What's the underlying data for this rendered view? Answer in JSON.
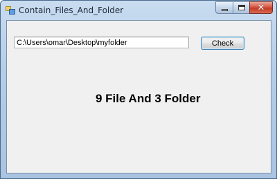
{
  "window": {
    "title": "Contain_Files_And_Folder",
    "controls": {
      "minimize": "minimize",
      "maximize": "maximize",
      "close": "close"
    }
  },
  "form": {
    "path_value": "C:\\Users\\omar\\Desktop\\myfolder",
    "check_label": "Check",
    "result_text": "9 File And 3 Folder"
  },
  "icons": {
    "app": "window-app-icon",
    "minimize": "minimize-icon",
    "maximize": "maximize-icon",
    "close": "close-icon"
  },
  "colors": {
    "titlebar": "#b4cde8",
    "client_background": "#f0f0f0",
    "close_button": "#c33a26",
    "button_border": "#3c7fb1"
  }
}
